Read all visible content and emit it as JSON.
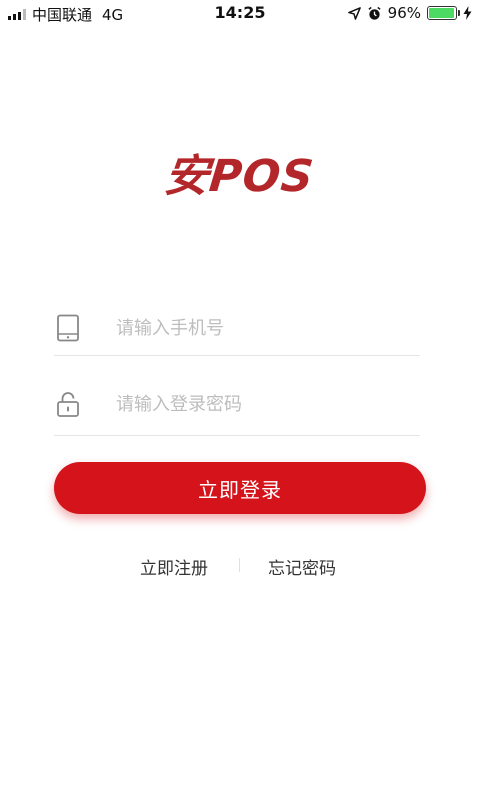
{
  "status_bar": {
    "carrier": "中国联通",
    "network": "4G",
    "time": "14:25",
    "battery_percent": "96%",
    "battery_level": 0.96,
    "battery_color": "#4cd964"
  },
  "logo": {
    "text": "安POS",
    "color": "#b3272b"
  },
  "form": {
    "phone_placeholder": "请输入手机号",
    "password_placeholder": "请输入登录密码",
    "phone_icon": "phone-icon",
    "password_icon": "lock-icon"
  },
  "login_button": {
    "label": "立即登录",
    "color": "#d4141a"
  },
  "links": {
    "register": "立即注册",
    "forgot_password": "忘记密码"
  }
}
